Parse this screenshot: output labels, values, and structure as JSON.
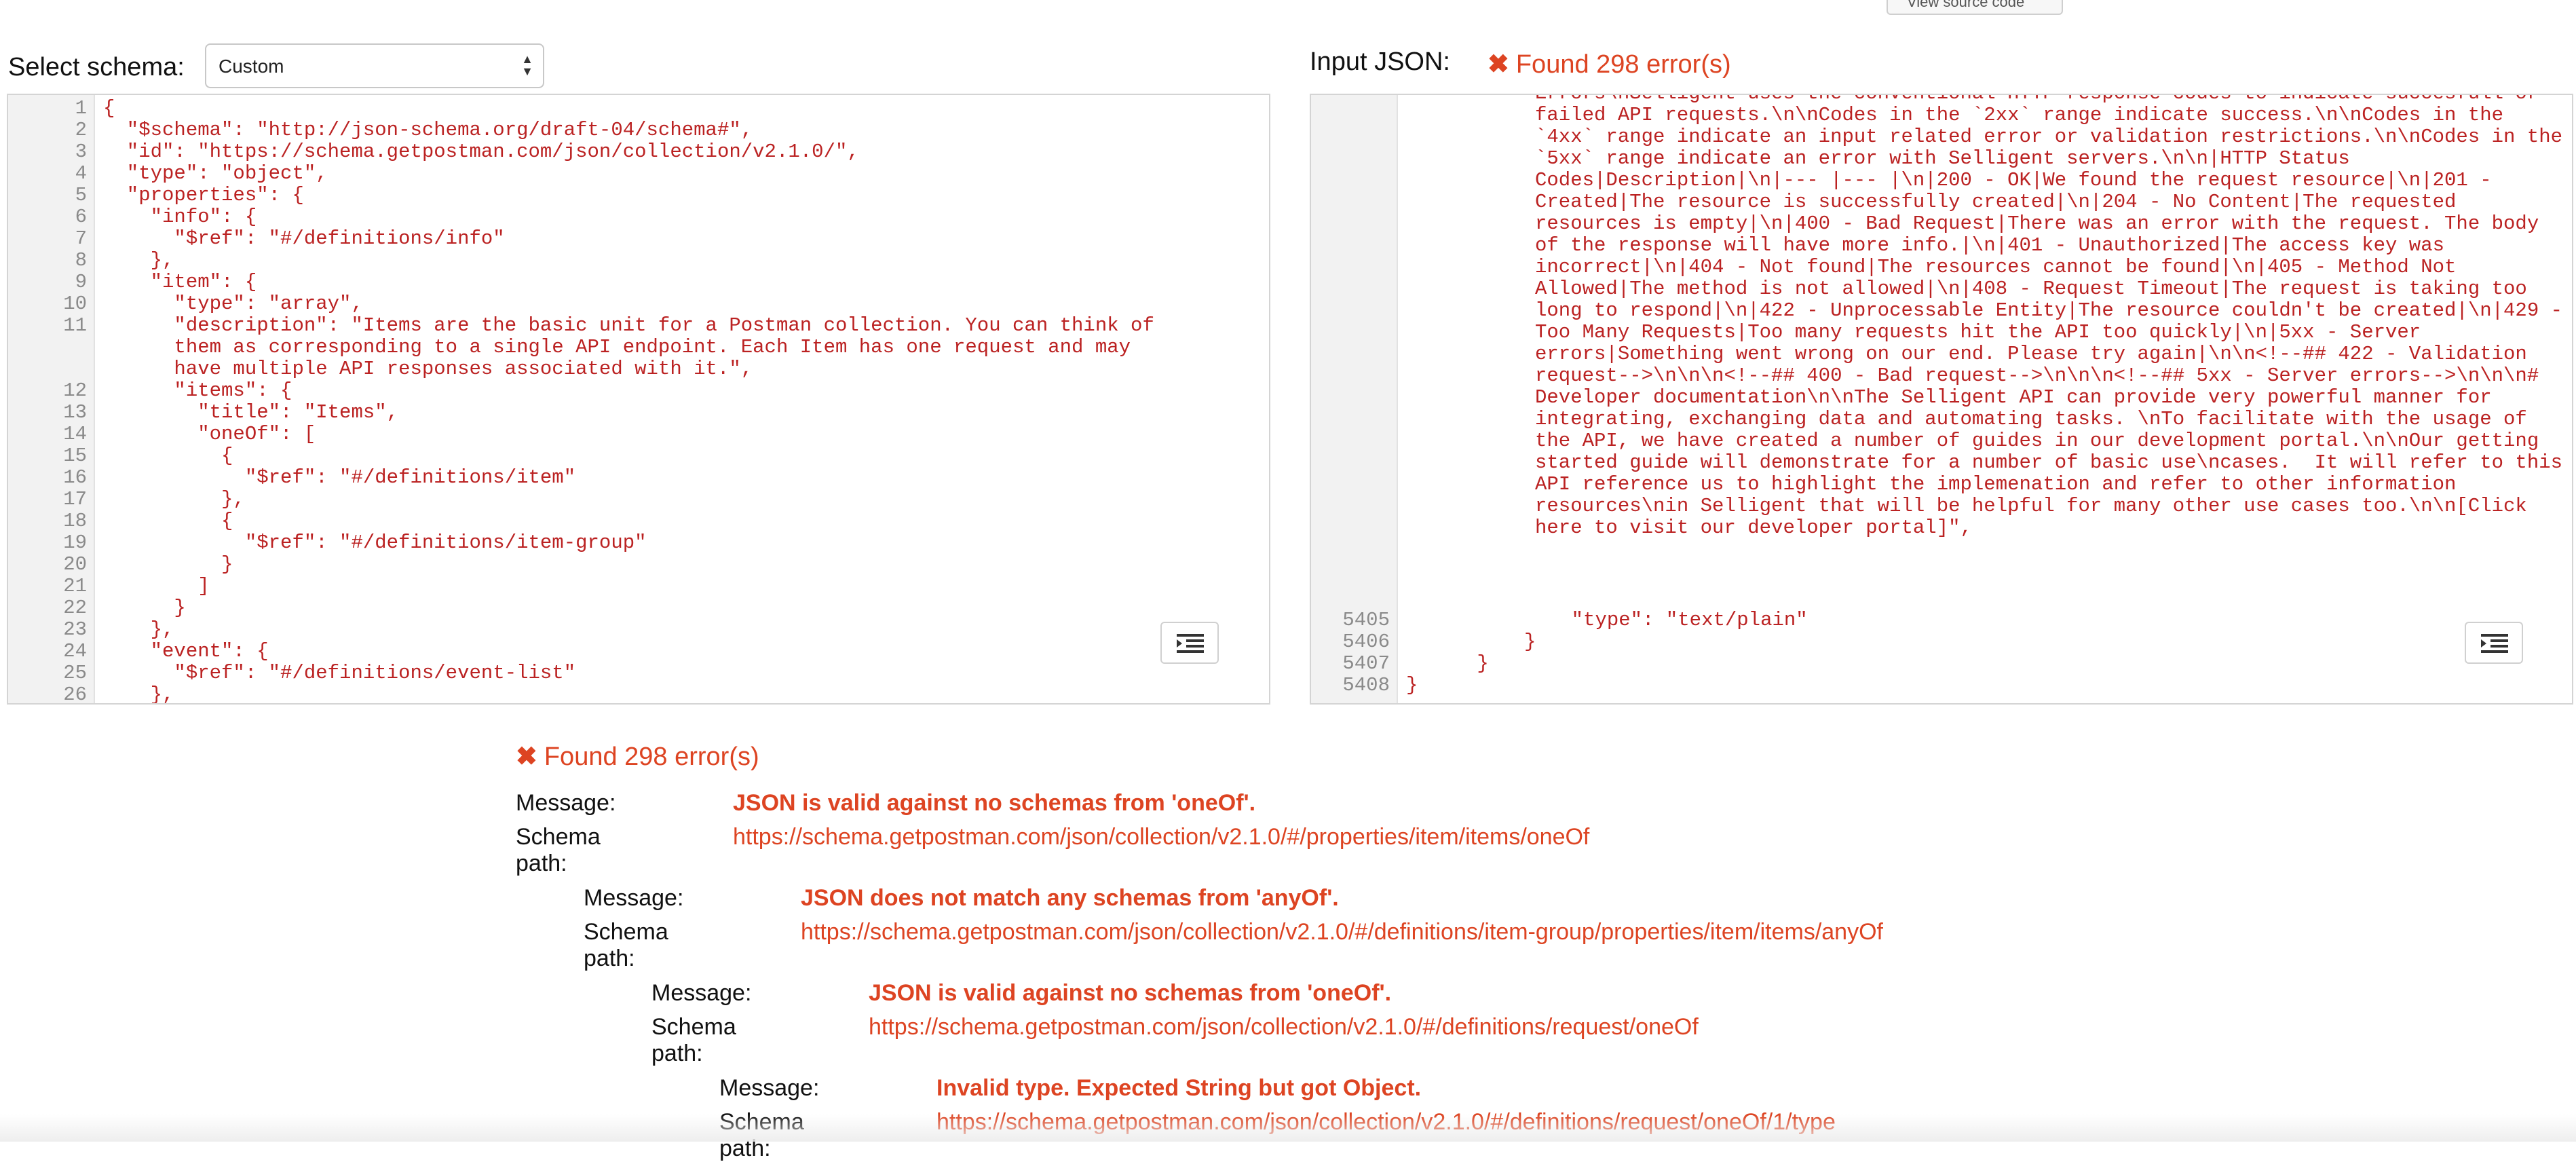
{
  "top_button": {
    "label": "View source code"
  },
  "schema_select": {
    "label": "Select schema:",
    "value": "Custom"
  },
  "input_json": {
    "label": "Input JSON:",
    "error_status": "Found 298 error(s)"
  },
  "schema_editor": {
    "lines": [
      {
        "n": "1",
        "t": "{"
      },
      {
        "n": "2",
        "t": "  \"$schema\": \"http://json-schema.org/draft-04/schema#\","
      },
      {
        "n": "3",
        "t": "  \"id\": \"https://schema.getpostman.com/json/collection/v2.1.0/\","
      },
      {
        "n": "4",
        "t": "  \"type\": \"object\","
      },
      {
        "n": "5",
        "t": "  \"properties\": {"
      },
      {
        "n": "6",
        "t": "    \"info\": {"
      },
      {
        "n": "7",
        "t": "      \"$ref\": \"#/definitions/info\""
      },
      {
        "n": "8",
        "t": "    },"
      },
      {
        "n": "9",
        "t": "    \"item\": {"
      },
      {
        "n": "10",
        "t": "      \"type\": \"array\","
      },
      {
        "n": "11",
        "t": "      \"description\": \"Items are the basic unit for a Postman collection. You can think of"
      },
      {
        "n": "",
        "t": "      them as corresponding to a single API endpoint. Each Item has one request and may"
      },
      {
        "n": "",
        "t": "      have multiple API responses associated with it.\","
      },
      {
        "n": "12",
        "t": "      \"items\": {"
      },
      {
        "n": "13",
        "t": "        \"title\": \"Items\","
      },
      {
        "n": "14",
        "t": "        \"oneOf\": ["
      },
      {
        "n": "15",
        "t": "          {"
      },
      {
        "n": "16",
        "t": "            \"$ref\": \"#/definitions/item\""
      },
      {
        "n": "17",
        "t": "          },"
      },
      {
        "n": "18",
        "t": "          {"
      },
      {
        "n": "19",
        "t": "            \"$ref\": \"#/definitions/item-group\""
      },
      {
        "n": "20",
        "t": "          }"
      },
      {
        "n": "21",
        "t": "        ]"
      },
      {
        "n": "22",
        "t": "      }"
      },
      {
        "n": "23",
        "t": "    },"
      },
      {
        "n": "24",
        "t": "    \"event\": {"
      },
      {
        "n": "25",
        "t": "      \"$ref\": \"#/definitions/event-list\""
      },
      {
        "n": "26",
        "t": "    },"
      }
    ]
  },
  "input_editor": {
    "wrapped_text": "Errors\\nSelligent uses the conventional HTTP response codes to indicate succesfull or failed API requests.\\n\\nCodes in the `2xx` range indicate success.\\n\\nCodes in the `4xx` range indicate an input related error or validation restrictions.\\n\\nCodes in the `5xx` range indicate an error with Selligent servers.\\n\\n|HTTP Status Codes|Description|\\n|--- |--- |\\n|200 - OK|We found the request resource|\\n|201 - Created|The resource is successfully created|\\n|204 - No Content|The requested resources is empty|\\n|400 - Bad Request|There was an error with the request. The body of the response will have more info.|\\n|401 - Unauthorized|The access key was incorrect|\\n|404 - Not found|The resources cannot be found|\\n|405 - Method Not Allowed|The method is not allowed|\\n|408 - Request Timeout|The request is taking too long to respond|\\n|422 - Unprocessable Entity|The resource couldn't be created|\\n|429 - Too Many Requests|Too many requests hit the API too quickly|\\n|5xx - Server errors|Something went wrong on our end. Please try again|\\n\\n<!--## 422 - Validation request-->\\n\\n\\n<!--## 400 - Bad request-->\\n\\n\\n<!--## 5xx - Server errors-->\\n\\n\\n# Developer documentation\\n\\nThe Selligent API can provide very powerful manner for integrating, exchanging data and automating tasks. \\nTo facilitate with the usage of the API, we have created a number of guides in our development portal.\\n\\nOur getting started guide will demonstrate for a number of basic use\\ncases.  It will refer to this API reference us to highlight the implemenation and refer to other information resources\\nin Selligent that will be helpful for many other use cases too.\\n\\n[Click here to visit our developer portal]\",",
    "lines": [
      {
        "n": "5405",
        "t": "              \"type\": \"text/plain\""
      },
      {
        "n": "5406",
        "t": "          }"
      },
      {
        "n": "5407",
        "t": "      }"
      },
      {
        "n": "5408",
        "t": "}"
      }
    ]
  },
  "results": {
    "summary": "Found 298 error(s)",
    "message_label": "Message:",
    "path_label": "Schema path:",
    "errors": [
      {
        "message": "JSON is valid against no schemas from 'oneOf'.",
        "path": "https://schema.getpostman.com/json/collection/v2.1.0/#/properties/item/items/oneOf"
      },
      {
        "message": "JSON does not match any schemas from 'anyOf'.",
        "path": "https://schema.getpostman.com/json/collection/v2.1.0/#/definitions/item-group/properties/item/items/anyOf"
      },
      {
        "message": "JSON is valid against no schemas from 'oneOf'.",
        "path": "https://schema.getpostman.com/json/collection/v2.1.0/#/definitions/request/oneOf"
      },
      {
        "message": "Invalid type. Expected String but got Object.",
        "path": "https://schema.getpostman.com/json/collection/v2.1.0/#/definitions/request/oneOf/1/type"
      }
    ]
  },
  "colors": {
    "error": "#d42222",
    "code_string": "#b22222",
    "gutter": "#f2f2f2"
  },
  "icons": {
    "format_button": "indent-lines-icon",
    "error_status": "x-icon"
  }
}
